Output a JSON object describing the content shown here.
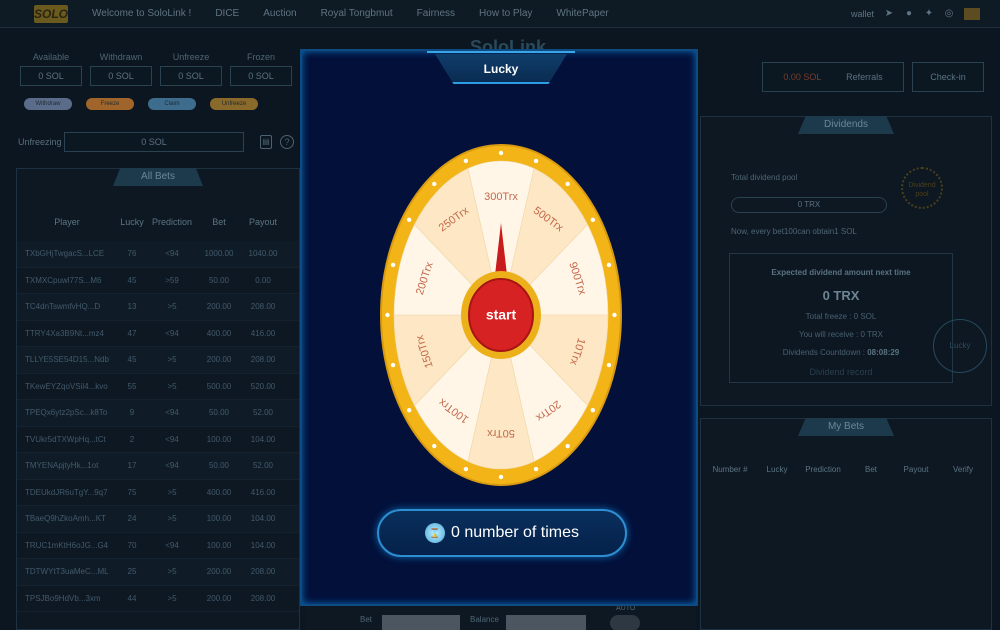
{
  "nav": {
    "logo": "SOLO",
    "items": [
      "Welcome to SoloLink !",
      "DICE",
      "Auction",
      "Royal Tongbmut",
      "Fairness",
      "How to Play",
      "WhitePaper"
    ],
    "wallet_label": "wallet"
  },
  "site_title": "SoloLink",
  "balances": [
    {
      "label": "Available",
      "value": "0 SOL"
    },
    {
      "label": "Withdrawn",
      "value": "0 SOL"
    },
    {
      "label": "Unfreeze",
      "value": "0 SOL"
    },
    {
      "label": "Frozen",
      "value": "0 SOL"
    }
  ],
  "action_pills": [
    {
      "label": "Withdraw",
      "color": "#5b6c8a"
    },
    {
      "label": "Freeze",
      "color": "#a0652a"
    },
    {
      "label": "Claim",
      "color": "#3d6c8d"
    },
    {
      "label": "Unfreeze",
      "color": "#8a6a2a"
    }
  ],
  "unfreezing": {
    "label": "Unfreezing",
    "value": "0 SOL"
  },
  "all_bets": {
    "title": "All Bets",
    "columns": [
      "Player",
      "Lucky",
      "Prediction",
      "Bet",
      "Payout"
    ],
    "rows": [
      [
        "TXbGHjTwgacS...LCE",
        "76",
        "<94",
        "1000.00",
        "1040.00"
      ],
      [
        "TXMXCpuwl77S...M6",
        "45",
        ">59",
        "50.00",
        "0.00"
      ],
      [
        "TC4dnTswmfvHQ...D",
        "13",
        ">5",
        "200.00",
        "208.00"
      ],
      [
        "TTRY4Xa3B9Nt...mz4",
        "47",
        "<94",
        "400.00",
        "416.00"
      ],
      [
        "TLLYE5SE54D15...Ndb",
        "45",
        ">5",
        "200.00",
        "208.00"
      ],
      [
        "TKewEYZqoVSil4...kvo",
        "55",
        ">5",
        "500.00",
        "520.00"
      ],
      [
        "TPEQx6ytz2pSc...k8To",
        "9",
        "<94",
        "50.00",
        "52.00"
      ],
      [
        "TVUkr5dTXWpHq...tCt",
        "2",
        "<94",
        "100.00",
        "104.00"
      ],
      [
        "TMYENApjtyHk...1ot",
        "17",
        "<94",
        "50.00",
        "52.00"
      ],
      [
        "TDEUkdJR6uTgY...9q7",
        "75",
        ">5",
        "400.00",
        "416.00"
      ],
      [
        "TBaeQ9hZkoAmh...KT",
        "24",
        ">5",
        "100.00",
        "104.00"
      ],
      [
        "TRUC1mKtH6oJG...G4",
        "70",
        "<94",
        "100.00",
        "104.00"
      ],
      [
        "TDTWYtT3uaMeC...ML",
        "25",
        ">5",
        "200.00",
        "208.00"
      ],
      [
        "TPSJBo9HdVb...3xm",
        "44",
        ">5",
        "200.00",
        "208.00"
      ]
    ]
  },
  "top_right": {
    "amount": "0.00 SOL",
    "referrals": "Referrals",
    "checkin": "Check-in"
  },
  "dividends": {
    "title": "Dividends",
    "pool_label": "Total dividend pool",
    "pool_value": "0 TRX",
    "pool_badge": "Dividend pool",
    "note": "Now, every bet100can obtain1 SOL",
    "expected_label": "Expected dividend amount next time",
    "expected_value": "0 TRX",
    "total_freeze": "Total freeze : 0 SOL",
    "you_receive": "You will receive : 0 TRX",
    "countdown_label": "Dividends Countdown :",
    "countdown_value": "08:08:29",
    "record": "Dividend record",
    "lucky_badge": "Lucky"
  },
  "my_bets": {
    "title": "My Bets",
    "columns": [
      "Number #",
      "Lucky",
      "Prediction",
      "Bet",
      "Payout",
      "Verify"
    ]
  },
  "bottom": {
    "bet_label": "Bet",
    "balance_label": "Balance",
    "auto_label": "AUTO"
  },
  "lucky_modal": {
    "title": "Lucky",
    "start_label": "start",
    "prizes": [
      "300Trx",
      "500Trx",
      "900Trx",
      "10Trx",
      "20Trx",
      "50Trx",
      "100Trx",
      "150Trx",
      "200Trx",
      "250Trx"
    ],
    "times_count": "0",
    "times_label": "number of times",
    "times_icon": "hourglass-icon"
  },
  "colors": {
    "rim": "#f2b417",
    "segment_light": "#fff6e8",
    "segment_dark": "#fde7c4",
    "prize_text": "#c4684b",
    "center": "#d62222",
    "accent": "#2d9ee6"
  }
}
